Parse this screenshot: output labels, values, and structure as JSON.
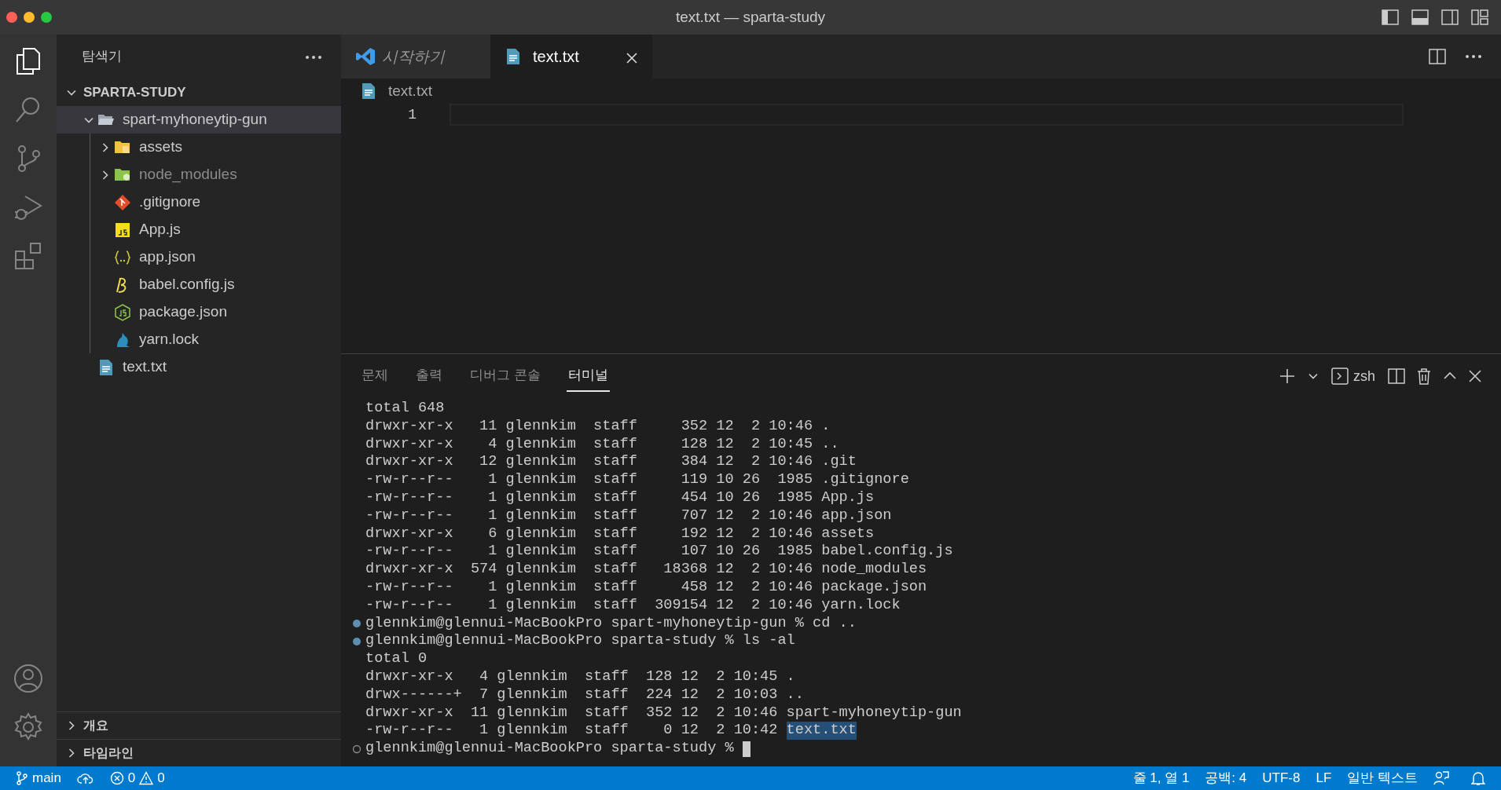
{
  "window": {
    "title": "text.txt — sparta-study"
  },
  "sidebar": {
    "title": "탐색기",
    "section": {
      "label": "SPARTA-STUDY",
      "expanded": true
    },
    "tree": [
      {
        "label": "spart-myhoneytip-gun",
        "kind": "folder-open",
        "expanded": true,
        "selected": true,
        "dimmed": false,
        "children": [
          {
            "label": "assets",
            "kind": "folder-assets",
            "expanded": false,
            "selected": false,
            "dimmed": false
          },
          {
            "label": "node_modules",
            "kind": "folder-node",
            "expanded": false,
            "selected": false,
            "dimmed": true
          },
          {
            "label": ".gitignore",
            "kind": "git",
            "selected": false,
            "dimmed": false
          },
          {
            "label": "App.js",
            "kind": "js",
            "selected": false,
            "dimmed": false
          },
          {
            "label": "app.json",
            "kind": "json",
            "selected": false,
            "dimmed": false
          },
          {
            "label": "babel.config.js",
            "kind": "babel",
            "selected": false,
            "dimmed": false
          },
          {
            "label": "package.json",
            "kind": "node",
            "selected": false,
            "dimmed": false
          },
          {
            "label": "yarn.lock",
            "kind": "yarn",
            "selected": false,
            "dimmed": false
          }
        ]
      },
      {
        "label": "text.txt",
        "kind": "text",
        "selected": false,
        "dimmed": false
      }
    ],
    "bottom_sections": [
      {
        "label": "개요",
        "expanded": false
      },
      {
        "label": "타임라인",
        "expanded": false
      }
    ]
  },
  "tabs": [
    {
      "label": "시작하기",
      "kind": "welcome",
      "preview": true,
      "selected": false
    },
    {
      "label": "text.txt",
      "kind": "text",
      "preview": false,
      "selected": true
    }
  ],
  "breadcrumb": "text.txt",
  "editor": {
    "line_numbers": [
      "1"
    ]
  },
  "panel": {
    "tabs": [
      {
        "label": "문제",
        "selected": false
      },
      {
        "label": "출력",
        "selected": false
      },
      {
        "label": "디버그 콘솔",
        "selected": false
      },
      {
        "label": "터미널",
        "selected": true
      }
    ],
    "shell": "zsh",
    "terminal": [
      {
        "text": "total 648"
      },
      {
        "text": "drwxr-xr-x   11 glennkim  staff     352 12  2 10:46 ."
      },
      {
        "text": "drwxr-xr-x    4 glennkim  staff     128 12  2 10:45 .."
      },
      {
        "text": "drwxr-xr-x   12 glennkim  staff     384 12  2 10:46 .git"
      },
      {
        "text": "-rw-r--r--    1 glennkim  staff     119 10 26  1985 .gitignore"
      },
      {
        "text": "-rw-r--r--    1 glennkim  staff     454 10 26  1985 App.js"
      },
      {
        "text": "-rw-r--r--    1 glennkim  staff     707 12  2 10:46 app.json"
      },
      {
        "text": "drwxr-xr-x    6 glennkim  staff     192 12  2 10:46 assets"
      },
      {
        "text": "-rw-r--r--    1 glennkim  staff     107 10 26  1985 babel.config.js"
      },
      {
        "text": "drwxr-xr-x  574 glennkim  staff   18368 12  2 10:46 node_modules"
      },
      {
        "text": "-rw-r--r--    1 glennkim  staff     458 12  2 10:46 package.json"
      },
      {
        "text": "-rw-r--r--    1 glennkim  staff  309154 12  2 10:46 yarn.lock"
      },
      {
        "text": "glennkim@glennui-MacBookPro spart-myhoneytip-gun % cd ..",
        "kind": "prompt",
        "completed": true
      },
      {
        "text": "glennkim@glennui-MacBookPro sparta-study % ls -al",
        "kind": "prompt",
        "completed": true
      },
      {
        "text": "total 0"
      },
      {
        "text": "drwxr-xr-x   4 glennkim  staff  128 12  2 10:45 ."
      },
      {
        "text": "drwx------+  7 glennkim  staff  224 12  2 10:03 .."
      },
      {
        "text": "drwxr-xr-x  11 glennkim  staff  352 12  2 10:46 spart-myhoneytip-gun"
      },
      {
        "text": "-rw-r--r--   1 glennkim  staff    0 12  2 10:42 ",
        "highlight": "text.txt"
      },
      {
        "text": "glennkim@glennui-MacBookPro sparta-study % ",
        "kind": "prompt",
        "completed": false,
        "cursor": true
      }
    ]
  },
  "status_bar": {
    "branch": "main",
    "errors": "0",
    "warnings": "0",
    "right": [
      "줄 1, 열 1",
      "공백: 4",
      "UTF-8",
      "LF",
      "일반 텍스트"
    ]
  }
}
